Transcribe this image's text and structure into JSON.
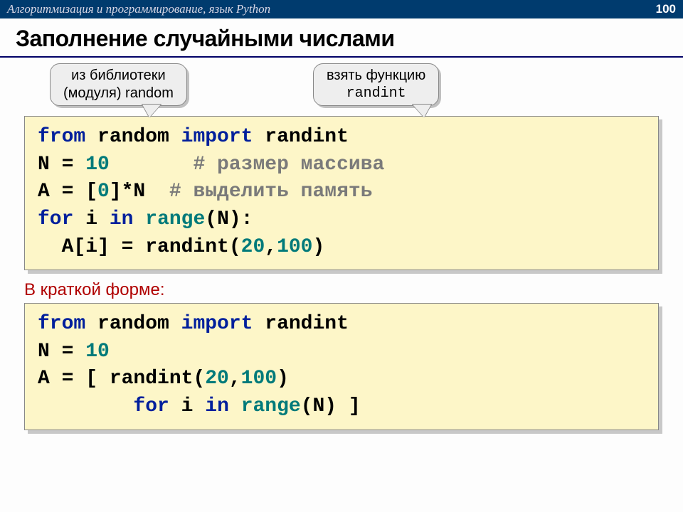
{
  "header": {
    "course": "Алгоритмизация и программирование, язык Python",
    "page": "100"
  },
  "title": "Заполнение случайными числами",
  "callouts": {
    "left_l1": "из библиотеки",
    "left_l2": "(модуля) random",
    "right_l1": "взять функцию",
    "right_l2": "randint"
  },
  "code1": {
    "l1_from": "from",
    "l1_mod": " random ",
    "l1_import": "import",
    "l1_name": " randint",
    "l2_pre": "N = ",
    "l2_num": "10",
    "l2_sp": "       ",
    "l2_cmt": "# размер массива",
    "l3_pre": "A = [",
    "l3_zero": "0",
    "l3_post": "]*N  ",
    "l3_cmt": "# выделить память",
    "l4_for": "for",
    "l4_mid": " i ",
    "l4_in": "in",
    "l4_sp2": " ",
    "l4_range": "range",
    "l4_tail": "(N):",
    "l5_pre": "  A[i] = randint(",
    "l5_a": "20",
    "l5_comma": ",",
    "l5_b": "100",
    "l5_close": ")"
  },
  "subtitle": "В краткой форме:",
  "code2": {
    "l1_from": "from",
    "l1_mod": " random ",
    "l1_import": "import",
    "l1_name": " randint",
    "l2_pre": "N = ",
    "l2_num": "10",
    "l3_pre": "A = [ randint(",
    "l3_a": "20",
    "l3_comma": ",",
    "l3_b": "100",
    "l3_close": ") ",
    "l4_sp": "        ",
    "l4_for": "for",
    "l4_mid": " i ",
    "l4_in": "in",
    "l4_sp2": " ",
    "l4_range": "range",
    "l4_tail": "(N) ]"
  }
}
